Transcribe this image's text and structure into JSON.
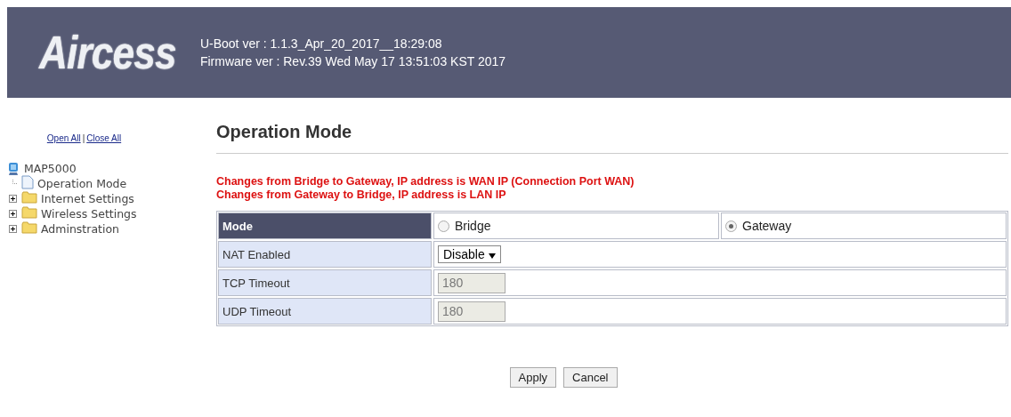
{
  "header": {
    "logo": "Aircess",
    "uboot_version": "U-Boot ver : 1.1.3_Apr_20_2017__18:29:08",
    "firmware_version": "Firmware ver : Rev.39 Wed May 17 13:51:03 KST 2017"
  },
  "sidebar": {
    "open_all": "Open All",
    "separator": "|",
    "close_all": "Close All",
    "tree": {
      "label": "MAP5000",
      "children": [
        {
          "label": "Operation Mode",
          "kind": "page"
        },
        {
          "label": "Internet Settings",
          "kind": "folder",
          "expanded": false
        },
        {
          "label": "Wireless Settings",
          "kind": "folder",
          "expanded": false
        },
        {
          "label": "Adminstration",
          "kind": "folder",
          "expanded": false
        }
      ]
    }
  },
  "page": {
    "title": "Operation Mode",
    "notes": [
      "Changes from Bridge to Gateway, IP address is WAN IP (Connection Port WAN)",
      "Changes from Gateway to Bridge, IP address is LAN IP"
    ],
    "rows": [
      {
        "kind": "radio",
        "label": "Mode",
        "options": [
          {
            "label": "Bridge",
            "selected": false
          },
          {
            "label": "Gateway",
            "selected": true
          }
        ]
      },
      {
        "kind": "select",
        "label": "NAT Enabled",
        "value": "Disable"
      },
      {
        "kind": "input",
        "label": "TCP Timeout",
        "value": "180",
        "disabled": true
      },
      {
        "kind": "input",
        "label": "UDP Timeout",
        "value": "180",
        "disabled": true
      }
    ],
    "buttons": [
      "Apply",
      "Cancel"
    ]
  }
}
